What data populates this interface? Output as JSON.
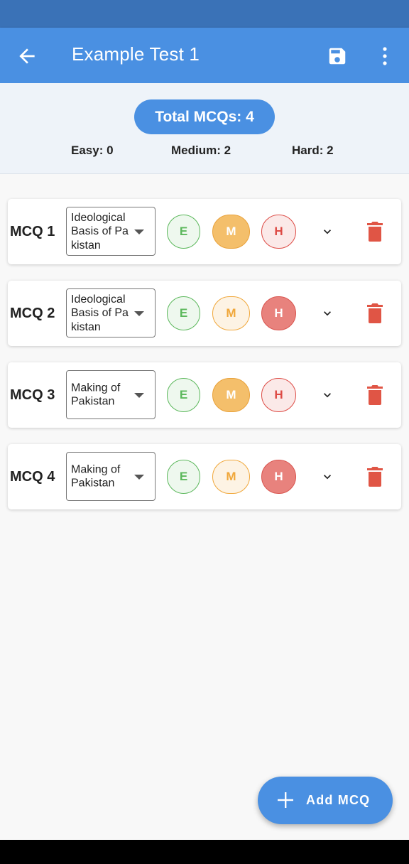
{
  "app_bar": {
    "title": "Example Test 1",
    "back_icon": "arrow-left-icon",
    "save_icon": "floppy-disk-icon",
    "more_icon": "more-vertical-icon"
  },
  "summary": {
    "total_label": "Total MCQs: 4",
    "easy_label": "Easy: 0",
    "medium_label": "Medium: 2",
    "hard_label": "Hard: 2"
  },
  "mcqs": [
    {
      "label": "MCQ 1",
      "topic": "Ideological Basis of Pakistan",
      "selected": "M"
    },
    {
      "label": "MCQ 2",
      "topic": "Ideological Basis of Pakistan",
      "selected": "H"
    },
    {
      "label": "MCQ 3",
      "topic": "Making of Pakistan",
      "selected": "M"
    },
    {
      "label": "MCQ 4",
      "topic": "Making of Pakistan",
      "selected": "H"
    }
  ],
  "difficulty_buttons": {
    "easy": "E",
    "medium": "M",
    "hard": "H"
  },
  "fab": {
    "label": "Add MCQ",
    "icon": "plus-icon"
  },
  "colors": {
    "primary": "#4a90e2",
    "status_bar": "#3a72b7",
    "easy": "#5cb85c",
    "medium": "#f0a73a",
    "hard": "#dd4b45"
  }
}
